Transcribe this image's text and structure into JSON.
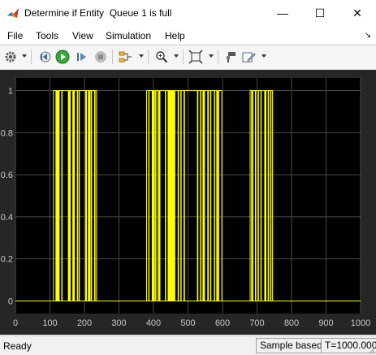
{
  "window": {
    "title": "Determine if Entity  Queue 1 is full",
    "minimize_glyph": "—",
    "maximize_glyph": "☐",
    "close_glyph": "✕"
  },
  "menu": {
    "items": [
      "File",
      "Tools",
      "View",
      "Simulation",
      "Help"
    ],
    "dock_glyph": "↘"
  },
  "toolbar": {
    "icons": [
      "settings-gear-icon",
      "step-back-icon",
      "run-icon",
      "step-forward-icon",
      "stop-icon",
      "signal-select-icon",
      "zoom-icon",
      "fit-to-view-icon",
      "style-icon",
      "highlight-icon"
    ]
  },
  "status": {
    "left": "Ready",
    "mode": "Sample based",
    "time": "T=1000.000"
  },
  "colors": {
    "axes_bg": "#000000",
    "figure_bg": "#262626",
    "signal": "#ffff00",
    "tick_text": "#c8c8c8",
    "grid": "#4a4a4a"
  },
  "chart_data": {
    "type": "line",
    "title": "",
    "xlabel": "",
    "ylabel": "",
    "xlim": [
      0,
      1000
    ],
    "ylim": [
      -0.06,
      1.06
    ],
    "xticks": [
      0,
      100,
      200,
      300,
      400,
      500,
      600,
      700,
      800,
      900,
      1000
    ],
    "yticks": [
      0,
      0.2,
      0.4,
      0.6,
      0.8,
      1
    ],
    "ytick_labels": [
      "0",
      "0.2",
      "0.4",
      "0.6",
      "0.8",
      "1"
    ],
    "grid": true,
    "series": [
      {
        "step": true,
        "on_intervals": [
          [
            116,
            128
          ],
          [
            133,
            135
          ],
          [
            152,
            160
          ],
          [
            165,
            172
          ],
          [
            178,
            181
          ],
          [
            183,
            185
          ],
          [
            202,
            207
          ],
          [
            210,
            217
          ],
          [
            218,
            222
          ],
          [
            228,
            232
          ],
          [
            385,
            388
          ],
          [
            395,
            397
          ],
          [
            398,
            404
          ],
          [
            405,
            408
          ],
          [
            412,
            414
          ],
          [
            416,
            420
          ],
          [
            433,
            436
          ],
          [
            441,
            463
          ],
          [
            470,
            473
          ],
          [
            478,
            481
          ],
          [
            487,
            491
          ],
          [
            526,
            530
          ],
          [
            535,
            538
          ],
          [
            542,
            549
          ],
          [
            556,
            560
          ],
          [
            564,
            567
          ],
          [
            575,
            578
          ],
          [
            582,
            590
          ],
          [
            683,
            689
          ],
          [
            694,
            697
          ],
          [
            702,
            705
          ],
          [
            710,
            713
          ],
          [
            721,
            727
          ],
          [
            731,
            734
          ],
          [
            738,
            741
          ]
        ],
        "envelope_intervals": [
          [
            110,
            235
          ],
          [
            380,
            598
          ],
          [
            680,
            745
          ]
        ]
      }
    ]
  }
}
